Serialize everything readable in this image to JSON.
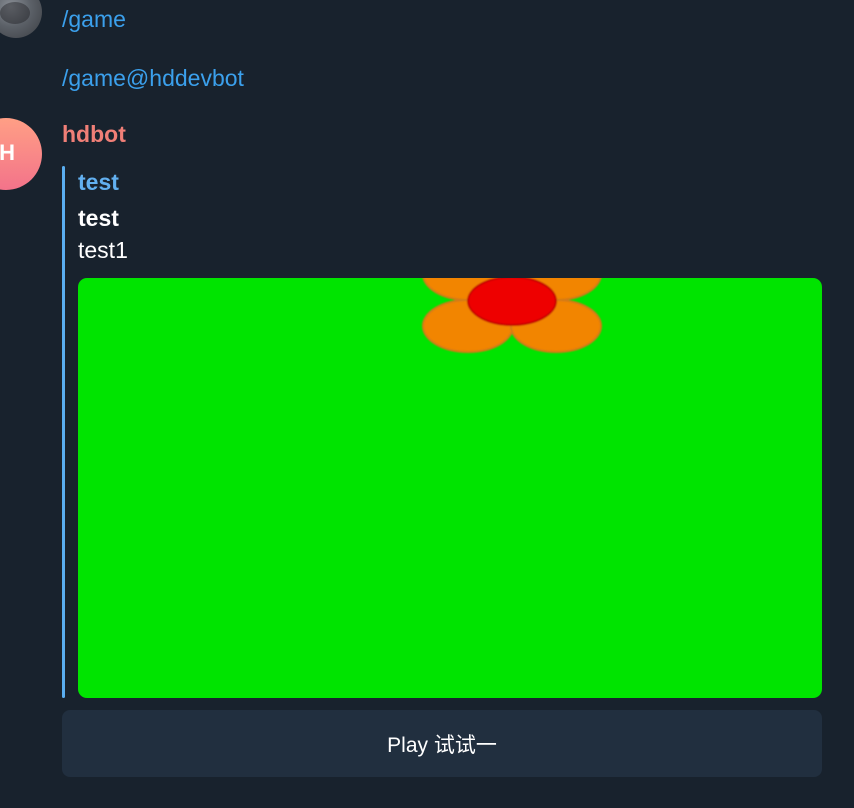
{
  "messages": {
    "command_1": "/game",
    "command_2": "/game@hddevbot",
    "bot": {
      "avatar_letter": "H",
      "avatar_gradient": [
        "#ff9f85",
        "#f3738a"
      ],
      "sender_name": "hdbot",
      "sender_color": "#f07f77"
    }
  },
  "game": {
    "title": "test",
    "name": "test",
    "description": "test1",
    "preview": {
      "background_color": "#00e400",
      "icons": [
        "flower-icon"
      ]
    },
    "accent_color": "#5aaef0"
  },
  "actions": {
    "play_label": "Play 试试一"
  },
  "theme": {
    "background": "#18222d",
    "link_color": "#3ba0ec",
    "button_background": "#212f3f"
  }
}
